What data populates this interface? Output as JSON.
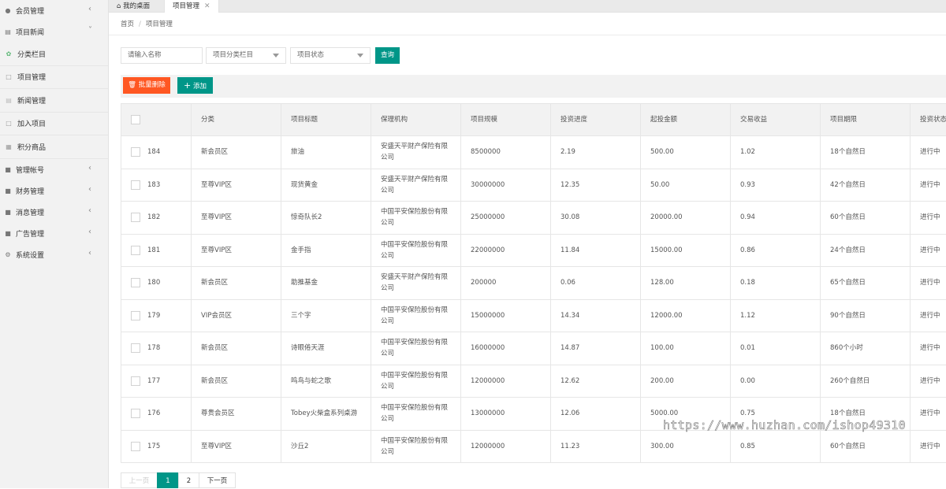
{
  "sidebar": {
    "top_items": [
      {
        "label": "会员管理",
        "icon": "user-icon"
      },
      {
        "label": "项目新闻",
        "icon": "news-icon"
      }
    ],
    "sub_items": [
      {
        "label": "分类栏目",
        "icon": "leaf-icon"
      },
      {
        "label": "项目管理",
        "icon": "cart-icon"
      },
      {
        "label": "新闻管理",
        "icon": "doc-icon"
      },
      {
        "label": "加入项目",
        "icon": "cart-icon"
      },
      {
        "label": "积分商品",
        "icon": "gift-icon"
      }
    ],
    "bottom_items": [
      {
        "label": "管理帐号",
        "icon": "account-icon"
      },
      {
        "label": "财务管理",
        "icon": "finance-icon"
      },
      {
        "label": "消息管理",
        "icon": "message-icon"
      },
      {
        "label": "广告管理",
        "icon": "ad-icon"
      },
      {
        "label": "系统设置",
        "icon": "gear-icon"
      }
    ]
  },
  "tabs": {
    "home": "我的桌面",
    "project": "项目管理",
    "close": "✕"
  },
  "breadcrumb": {
    "home": "首页",
    "sep": "/",
    "current": "项目管理"
  },
  "filters": {
    "name_placeholder": "请输入名称",
    "category_select": "项目分类栏目",
    "status_select": "项目状态",
    "query_button": "查询"
  },
  "toolbar": {
    "batch_delete": "批量删除",
    "add": "添加"
  },
  "table": {
    "headers": [
      "分类",
      "项目标题",
      "保理机构",
      "项目规模",
      "投资进度",
      "起投金额",
      "交易收益",
      "项目期限",
      "投资状态"
    ],
    "rows": [
      {
        "id": "184",
        "category": "新会员区",
        "title": "旅油",
        "org": "安盛天平财产保险有限公司",
        "scale": "8500000",
        "progress": "2.19",
        "min_invest": "500.00",
        "yield": "1.02",
        "term": "18个自然日",
        "status": "进行中"
      },
      {
        "id": "183",
        "category": "至尊VIP区",
        "title": "现货黄金",
        "org": "安盛天平财产保险有限公司",
        "scale": "30000000",
        "progress": "12.35",
        "min_invest": "50.00",
        "yield": "0.93",
        "term": "42个自然日",
        "status": "进行中"
      },
      {
        "id": "182",
        "category": "至尊VIP区",
        "title": "惊奇队长2",
        "org": "中国平安保险股份有限公司",
        "scale": "25000000",
        "progress": "30.08",
        "min_invest": "20000.00",
        "yield": "0.94",
        "term": "60个自然日",
        "status": "进行中"
      },
      {
        "id": "181",
        "category": "至尊VIP区",
        "title": "金手指",
        "org": "中国平安保险股份有限公司",
        "scale": "22000000",
        "progress": "11.84",
        "min_invest": "15000.00",
        "yield": "0.86",
        "term": "24个自然日",
        "status": "进行中"
      },
      {
        "id": "180",
        "category": "新会员区",
        "title": "助推基金",
        "org": "安盛天平财产保险有限公司",
        "scale": "200000",
        "progress": "0.06",
        "min_invest": "128.00",
        "yield": "0.18",
        "term": "65个自然日",
        "status": "进行中"
      },
      {
        "id": "179",
        "category": "VIP会员区",
        "title": "三个字",
        "org": "中国平安保险股份有限公司",
        "scale": "15000000",
        "progress": "14.34",
        "min_invest": "12000.00",
        "yield": "1.12",
        "term": "90个自然日",
        "status": "进行中"
      },
      {
        "id": "178",
        "category": "新会员区",
        "title": "诗眼倦天涯",
        "org": "中国平安保险股份有限公司",
        "scale": "16000000",
        "progress": "14.87",
        "min_invest": "100.00",
        "yield": "0.01",
        "term": "860个小时",
        "status": "进行中"
      },
      {
        "id": "177",
        "category": "新会员区",
        "title": "鸣鸟与蛇之歌",
        "org": "中国平安保险股份有限公司",
        "scale": "12000000",
        "progress": "12.62",
        "min_invest": "200.00",
        "yield": "0.00",
        "term": "260个自然日",
        "status": "进行中"
      },
      {
        "id": "176",
        "category": "尊贵会员区",
        "title": "Tobey火柴盒系列桌游",
        "org": "中国平安保险股份有限公司",
        "scale": "13000000",
        "progress": "12.06",
        "min_invest": "5000.00",
        "yield": "0.75",
        "term": "18个自然日",
        "status": "进行中"
      },
      {
        "id": "175",
        "category": "至尊VIP区",
        "title": "沙丘2",
        "org": "中国平安保险股份有限公司",
        "scale": "12000000",
        "progress": "11.23",
        "min_invest": "300.00",
        "yield": "0.85",
        "term": "60个自然日",
        "status": "进行中"
      }
    ]
  },
  "pagination": {
    "prev": "上一页",
    "pages": [
      "1",
      "2"
    ],
    "current": "1",
    "next": "下一页"
  },
  "watermark": "https://www.huzhan.com/ishop49310",
  "colors": {
    "accent": "#009688",
    "danger": "#ff5722"
  }
}
